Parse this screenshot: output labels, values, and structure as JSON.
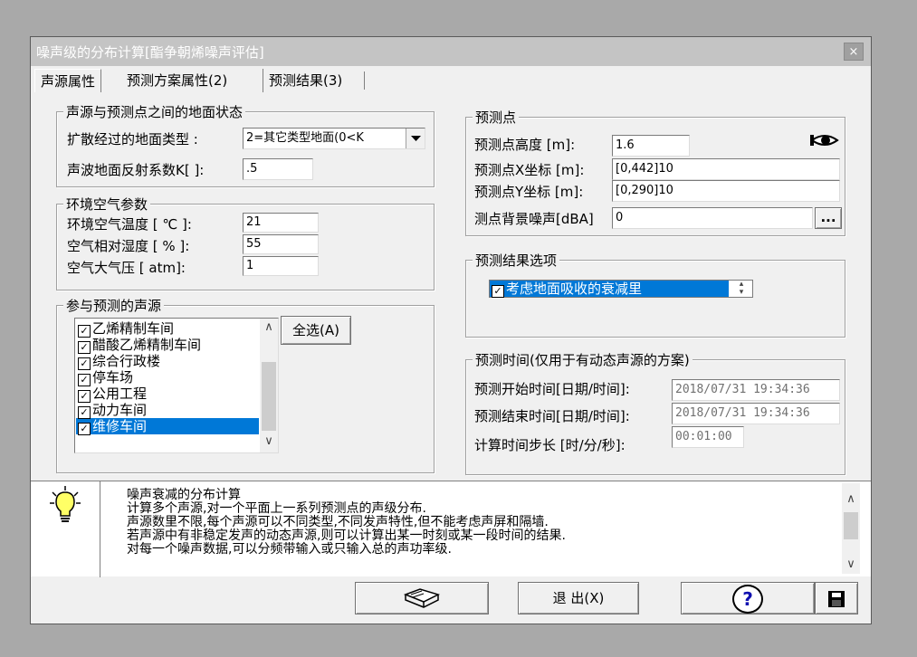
{
  "window": {
    "title": "噪声级的分布计算[酯争朝烯噪声评估]",
    "close": "×"
  },
  "tabs": [
    {
      "label": "声源属性"
    },
    {
      "label": "预测方案属性(2)"
    },
    {
      "label": "预测结果(3)"
    }
  ],
  "ground": {
    "title": "声源与预测点之间的地面状态",
    "type_label": "扩散经过的地面类型 :",
    "type_value": "2=其它类型地面(0<K",
    "k_label": "声波地面反射系数K[ ]:",
    "k_value": ".5"
  },
  "air": {
    "title": "环境空气参数",
    "temp_label": "环境空气温度 [ ℃ ]:",
    "temp_value": "21",
    "hum_label": "空气相对湿度 [ % ]:",
    "hum_value": "55",
    "pres_label": "空气大气压 [ atm]:",
    "pres_value": "1"
  },
  "sources": {
    "title": "参与预测的声源",
    "select_all": "全选(A)",
    "items": [
      {
        "label": "乙烯精制车间",
        "checked": "✓"
      },
      {
        "label": "醋酸乙烯精制车间",
        "checked": "✓"
      },
      {
        "label": "综合行政楼",
        "checked": "✓"
      },
      {
        "label": "停车场",
        "checked": "✓"
      },
      {
        "label": "公用工程",
        "checked": "✓"
      },
      {
        "label": "动力车间",
        "checked": "✓"
      },
      {
        "label": "维修车间",
        "checked": "✓"
      }
    ]
  },
  "point": {
    "title": "预测点",
    "height_label": "预测点高度 [m]:",
    "height_value": "1.6",
    "x_label": "预测点X坐标 [m]:",
    "x_value": "[0,442]10",
    "y_label": "预测点Y坐标 [m]:",
    "y_value": "[0,290]10",
    "bg_label": "测点背景噪声[dBA]",
    "bg_value": "0",
    "more": "..."
  },
  "result_opts": {
    "title": "预测结果选项",
    "option": {
      "label": "考虑地面吸收的衰减里",
      "checked": "✓"
    }
  },
  "time": {
    "title": "预测时间(仅用于有动态声源的方案)",
    "start_label": "预测开始时间[日期/时间]:",
    "start_value": "2018/07/31 19:34:36",
    "end_label": "预测结束时间[日期/时间]:",
    "end_value": "2018/07/31 19:34:36",
    "step_label": "计算时间步长 [时/分/秒]:",
    "step_value": "00:01:00"
  },
  "help": {
    "lines": [
      "噪声衰减的分布计算",
      "计算多个声源,对一个平面上一系列预测点的声级分布.",
      "声源数里不限,每个声源可以不同类型,不同发声特性,但不能考虑声屏和隔墙.",
      "若声源中有非稳定发声的动态声源,则可以计算出某一时刻或某一段时间的结果.",
      "对每一个噪声数据,可以分频带输入或只输入总的声功率级."
    ]
  },
  "buttons": {
    "exit": "退 出(X)",
    "help": "?"
  },
  "colors": {
    "selection": "#0078d7",
    "titlebar": "#c4c4c4"
  }
}
